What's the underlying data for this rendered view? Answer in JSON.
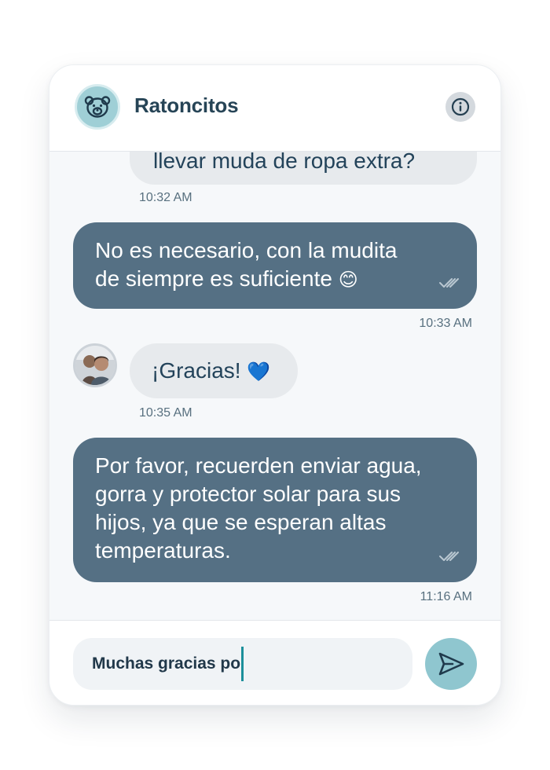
{
  "header": {
    "title": "Ratoncitos",
    "avatar_icon": "bear-icon",
    "info_icon": "info-icon"
  },
  "messages": [
    {
      "direction": "incoming",
      "text": "llevar muda de ropa extra?",
      "time": "10:32 AM"
    },
    {
      "direction": "outgoing",
      "line1": "No es necesario, con la mudita",
      "line2": "de siempre es suficiente",
      "emoji": "😊",
      "time": "10:33 AM",
      "status": "read"
    },
    {
      "direction": "incoming",
      "text": "¡Gracias!",
      "emoji": "💙",
      "time": "10:35 AM"
    },
    {
      "direction": "outgoing",
      "line1": "Por favor, recuerden enviar agua,",
      "line2": "gorra y protector solar para sus",
      "line3": "hijos, ya que se esperan altas",
      "line4": "temperaturas.",
      "time": "11:16 AM",
      "status": "read"
    }
  ],
  "composer": {
    "value": "Muchas gracias po",
    "send_icon": "send-icon"
  },
  "colors": {
    "accent": "#8fc6cf",
    "outgoing_bubble": "#557084",
    "incoming_bubble": "#e7eaed",
    "title": "#264456"
  }
}
